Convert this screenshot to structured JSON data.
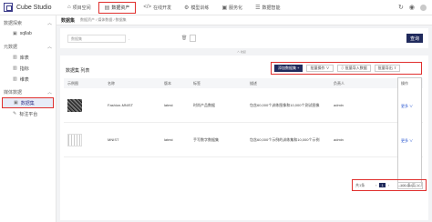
{
  "app": {
    "name": "Cube Studio"
  },
  "nav": [
    {
      "icon": "home-icon",
      "glyph": "⌂",
      "label": "项目空间",
      "active": false
    },
    {
      "icon": "database-icon",
      "glyph": "▤",
      "label": "数据资产",
      "active": true
    },
    {
      "icon": "code-icon",
      "glyph": "</>",
      "label": "在线开发",
      "active": false
    },
    {
      "icon": "model-icon",
      "glyph": "⚙",
      "label": "模型训练",
      "active": false
    },
    {
      "icon": "service-icon",
      "glyph": "▣",
      "label": "服务化",
      "active": false
    },
    {
      "icon": "data-intel-icon",
      "glyph": "☰",
      "label": "数据智能",
      "active": false
    }
  ],
  "topRight": {
    "refreshGlyph": "↻",
    "githubGlyph": "◉"
  },
  "sidebar": {
    "sections": [
      {
        "label": "数据探索",
        "items": [
          {
            "label": "sqllab",
            "glyph": "▣",
            "icon": "sql-icon"
          }
        ]
      },
      {
        "label": "元数据",
        "items": [
          {
            "label": "库表",
            "glyph": "▥",
            "icon": "table-icon"
          },
          {
            "label": "指标",
            "glyph": "▥",
            "icon": "metric-icon"
          },
          {
            "label": "维表",
            "glyph": "▥",
            "icon": "dimension-icon"
          }
        ]
      },
      {
        "label": "媒体数据",
        "items": [
          {
            "label": "数据集",
            "glyph": "▣",
            "icon": "dataset-icon",
            "active": true
          },
          {
            "label": "标注平台",
            "glyph": "✎",
            "icon": "annotate-icon"
          }
        ]
      }
    ],
    "collapseGlyph": "︿"
  },
  "tabbar": {
    "title": "数据集",
    "crumb": "数据资产 / 媒体数据 / 数据集"
  },
  "filter": {
    "placeholder": "数据集",
    "sep": "-",
    "query": "查询",
    "collapse": "∧ 收起"
  },
  "card": {
    "title": "数据集 列表"
  },
  "toolbar": {
    "add": "添加数据集 +",
    "batch": "批量操作 ∨",
    "import": "⇩ 批量导入数据",
    "export": "批量导出 ⇪"
  },
  "table": {
    "headers": [
      "示例图",
      "名称",
      "版本",
      "标签",
      "描述",
      "负责人",
      "操作"
    ],
    "rows": [
      {
        "thumb": "dark",
        "name": "Fashion-MNIST",
        "version": "latest",
        "label": "时尚产品数据",
        "desc": "包含60,000个训练图像和10,000个测试图像",
        "owner": "admin",
        "ops": "更多 ∨"
      },
      {
        "thumb": "light",
        "name": "MNIST",
        "version": "latest",
        "label": "手写数字数据集",
        "desc": "包含60,000个示例的训练集和10,000个示例",
        "owner": "admin",
        "ops": "更多 ∨"
      }
    ]
  },
  "pager": {
    "total": "共1条",
    "prev": "‹",
    "current": "1",
    "next": "›",
    "size": "100 条/页 ∨"
  }
}
